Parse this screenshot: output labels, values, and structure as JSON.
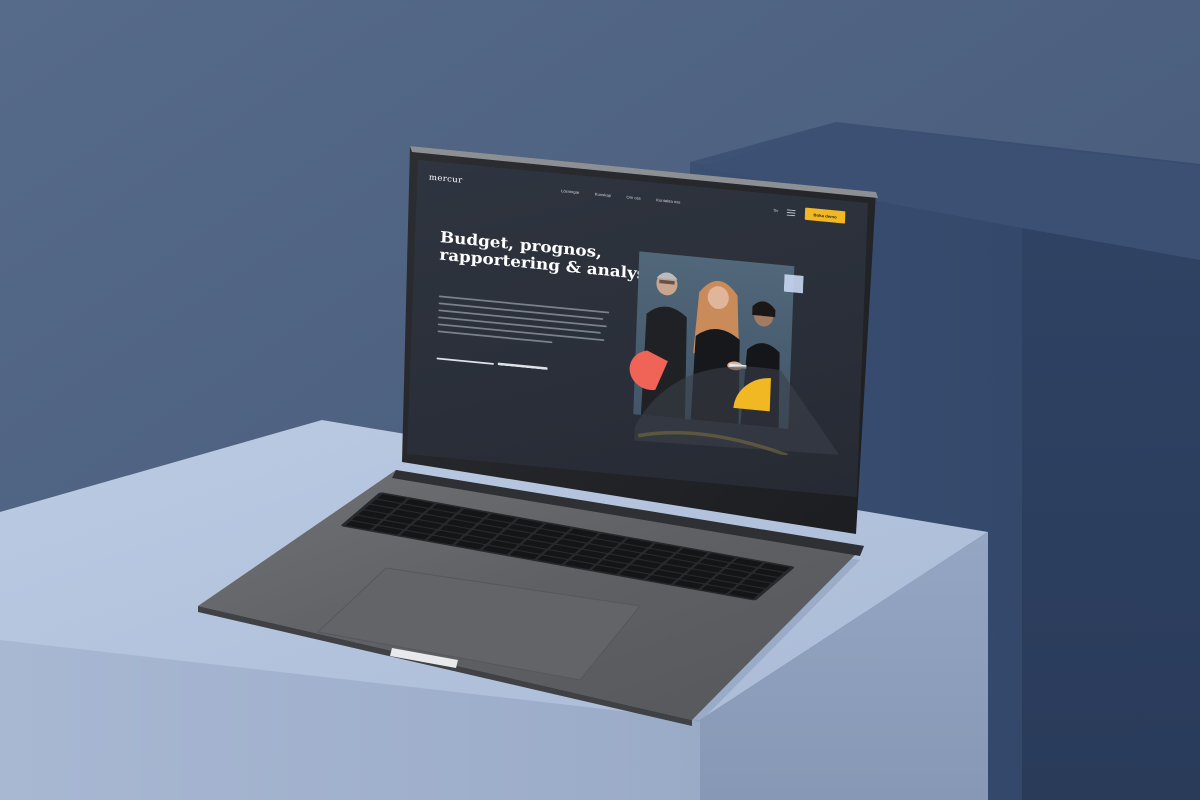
{
  "site": {
    "logo": "mercur",
    "nav": [
      "Lösningar",
      "Kunskap",
      "Om oss",
      "Kontakta oss"
    ],
    "lang": "Sv",
    "cta_label": "Boka demo"
  },
  "hero": {
    "title_lines": [
      "Budget, prognos,",
      "rapportering & analys"
    ]
  },
  "colors": {
    "wall": "#4b5d7c",
    "pedestal_top": "#b2c2dc",
    "laptop_body": "#5c5e62",
    "screen_bg": "#2c313b",
    "accent_yellow": "#f2b824",
    "accent_red": "#f06458",
    "accent_light_blue": "#c6d6f2"
  },
  "icons": [
    "menu-icon"
  ]
}
